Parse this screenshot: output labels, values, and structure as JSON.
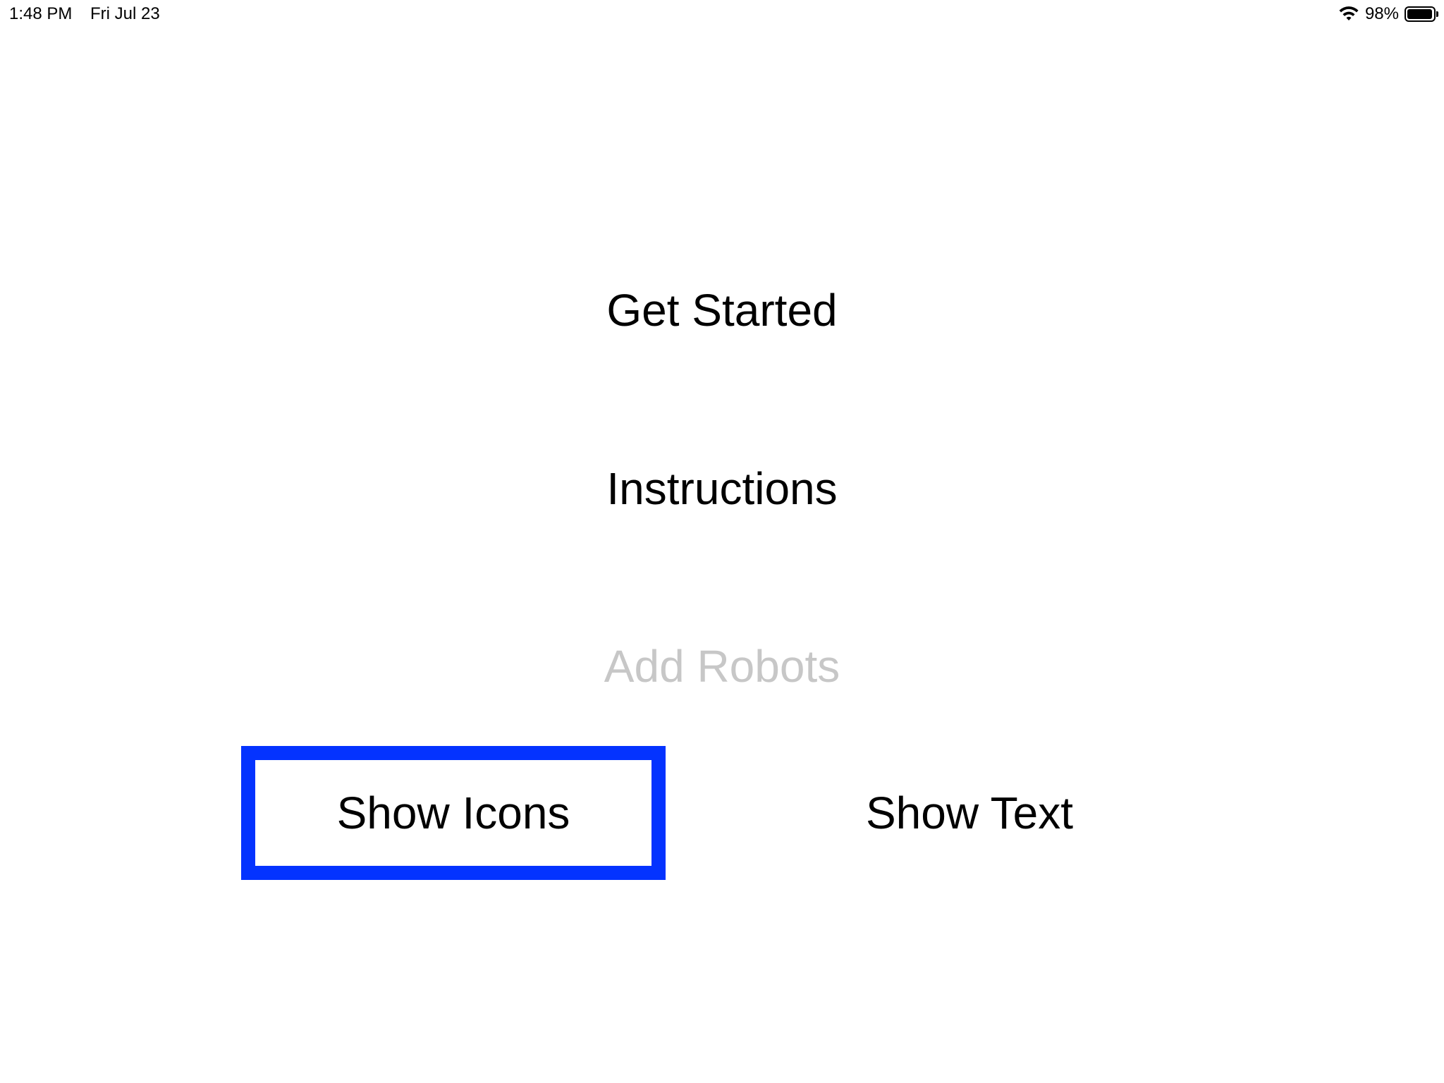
{
  "status_bar": {
    "time": "1:48 PM",
    "date": "Fri Jul 23",
    "battery_percent": "98%",
    "battery_level": 0.98,
    "wifi_icon": "wifi-icon",
    "battery_icon": "battery-icon"
  },
  "menu": {
    "get_started": "Get Started",
    "instructions": "Instructions",
    "add_robots": "Add Robots"
  },
  "view_toggle": {
    "show_icons": "Show Icons",
    "show_text": "Show Text",
    "selected": "Show Icons"
  },
  "colors": {
    "selection_border": "#0433ff",
    "disabled_text": "#c7c7c7",
    "text": "#000000",
    "background": "#ffffff"
  }
}
